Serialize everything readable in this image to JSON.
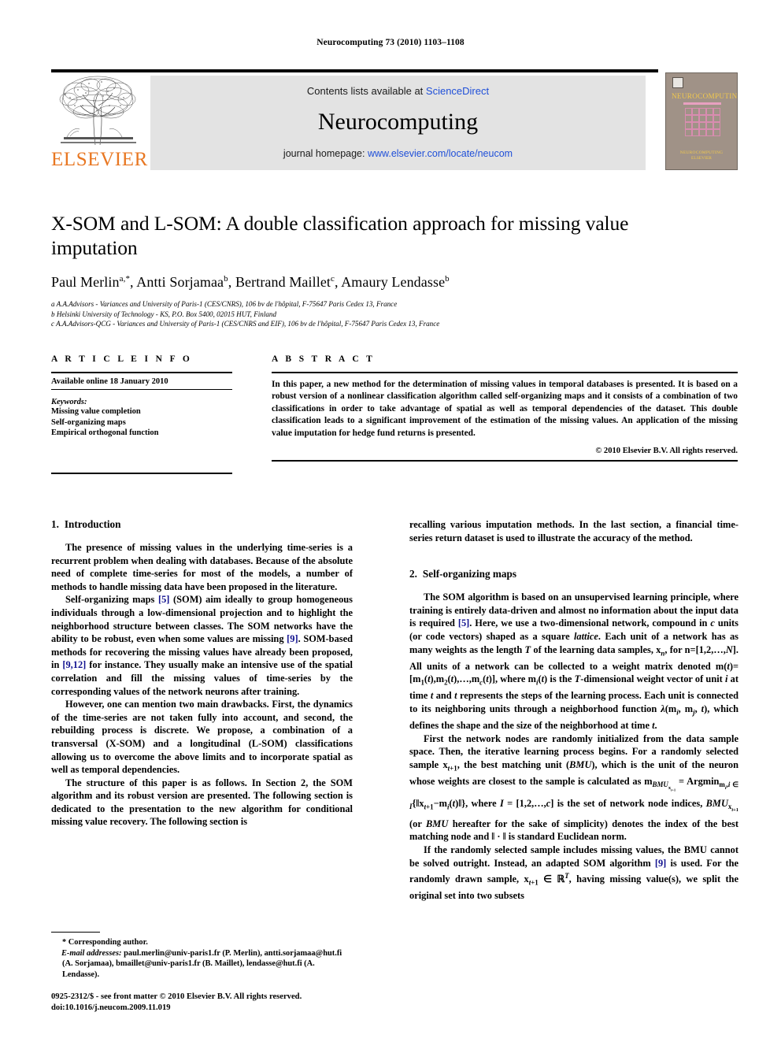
{
  "running_head": "Neurocomputing 73 (2010) 1103–1108",
  "masthead": {
    "contents_prefix": "Contents lists available at ",
    "contents_link": "ScienceDirect",
    "journal_name": "Neurocomputing",
    "homepage_prefix": "journal homepage: ",
    "homepage_link": "www.elsevier.com/locate/neucom",
    "publisher": "ELSEVIER",
    "cover": {
      "title": "NEUROCOMPUTING",
      "foot_line1": "NEUROCOMPUTING",
      "foot_line2": "ELSEVIER"
    }
  },
  "article": {
    "title": "X-SOM and L-SOM: A double classification approach for missing value imputation",
    "authors": "Paul Merlin a,*, Antti Sorjamaa b, Bertrand Maillet c, Amaury Lendasse b",
    "affiliations": [
      "a A.A.Advisors - Variances and University of Paris-1 (CES/CNRS), 106 bv de l'hôpital, F-75647 Paris Cedex 13, France",
      "b Helsinki University of Technology - KS, P.O. Box 5400, 02015 HUT, Finland",
      "c A.A.Advisors-QCG - Variances and University of Paris-1 (CES/CNRS and EIF), 106 bv de l'hôpital, F-75647 Paris Cedex 13, France"
    ]
  },
  "info": {
    "heading": "A R T I C L E  I N F O",
    "history": "Available online 18 January 2010",
    "keywords_label": "Keywords:",
    "keywords": [
      "Missing value completion",
      "Self-organizing maps",
      "Empirical orthogonal function"
    ]
  },
  "abstract": {
    "heading": "A B S T R A C T",
    "text": "In this paper, a new method for the determination of missing values in temporal databases is presented. It is based on a robust version of a nonlinear classification algorithm called self-organizing maps and it consists of a combination of two classifications in order to take advantage of spatial as well as temporal dependencies of the dataset. This double classification leads to a significant improvement of the estimation of the missing values. An application of the missing value imputation for hedge fund returns is presented.",
    "copyright": "© 2010 Elsevier B.V. All rights reserved."
  },
  "sections": {
    "intro": {
      "number": "1.",
      "title": "Introduction",
      "p1": "The presence of missing values in the underlying time-series is a recurrent problem when dealing with databases. Because of the absolute need of complete time-series for most of the models, a number of methods to handle missing data have been proposed in the literature.",
      "p2_a": "Self-organizing maps ",
      "p2_ref1": "[5]",
      "p2_b": " (SOM) aim ideally to group homogeneous individuals through a low-dimensional projection and to highlight the neighborhood structure between classes. The SOM networks have the ability to be robust, even when some values are missing ",
      "p2_ref2": "[9]",
      "p2_c": ". SOM-based methods for recovering the missing values have already been proposed, in ",
      "p2_ref3": "[9,12]",
      "p2_d": " for instance. They usually make an intensive use of the spatial correlation and fill the missing values of time-series by the corresponding values of the network neurons after training.",
      "p3": "However, one can mention two main drawbacks. First, the dynamics of the time-series are not taken fully into account, and second, the rebuilding process is discrete. We propose, a combination of a transversal (X-SOM) and a longitudinal (L-SOM) classifications allowing us to overcome the above limits and to incorporate spatial as well as temporal dependencies.",
      "p4": "The structure of this paper is as follows. In Section 2, the SOM algorithm and its robust version are presented. The following section is dedicated to the presentation to the new algorithm for conditional missing value recovery. The following section is recalling various imputation methods. In the last section, a financial time-series return dataset is used to illustrate the accuracy of the method."
    },
    "som": {
      "number": "2.",
      "title": "Self-organizing maps",
      "p1_a": "The SOM algorithm is based on an unsupervised learning principle, where training is entirely data-driven and almost no information about the input data is required ",
      "p1_ref": "[5]",
      "p1_b": ". Here, we use a two-dimensional network, compound in c units (or code vectors) shaped as a square lattice. Each unit of a network has as many weights as the length T of the learning data samples, x",
      "p1_c": ", for n=[1,2,…,N]. All units of a network can be collected to a weight matrix denoted m(t)=[m",
      "p1_d": "(t),m",
      "p1_e": "(t),…,m",
      "p1_f": "(t)], where m",
      "p1_g": "(t) is the T-dimensional weight vector of unit i at time t and t represents the steps of the learning process. Each unit is connected to its neighboring units through a neighborhood function λ(m",
      "p1_h": ", m",
      "p1_i": ", t), which defines the shape and the size of the neighborhood at time t.",
      "p2_a": "First the network nodes are randomly initialized from the data sample space. Then, the iterative learning process begins. For a randomly selected sample x",
      "p2_b": ", the best matching unit (BMU), which is the unit of the neuron whose weights are closest to the sample is calculated as m",
      "p2_c": " = Argmin",
      "p2_d": "{‖x",
      "p2_e": "−m",
      "p2_f": "(t)‖}, where I = [1,2,…,c] is the set of network node indices, BMU",
      "p2_g": " (or BMU hereafter for the sake of simplicity) denotes the index of the best matching node and ‖ · ‖ is standard Euclidean norm.",
      "p3_a": "If the randomly selected sample includes missing values, the BMU cannot be solved outright. Instead, an adapted SOM algorithm ",
      "p3_ref": "[9]",
      "p3_b": " is used. For the randomly drawn sample, x",
      "p3_c": " ∈ ℝ",
      "p3_d": ", having missing value(s), we split the original set into two subsets"
    }
  },
  "footnote": {
    "corresponding": "* Corresponding author.",
    "email_label": "E-mail addresses:",
    "emails": "paul.merlin@univ-paris1.fr (P. Merlin), antti.sorjamaa@hut.fi (A. Sorjamaa), bmaillet@univ-paris1.fr (B. Maillet), lendasse@hut.fi (A. Lendasse)."
  },
  "issn": {
    "line1": "0925-2312/$ - see front matter © 2010 Elsevier B.V. All rights reserved.",
    "line2": "doi:10.1016/j.neucom.2009.11.019"
  },
  "colors": {
    "link": "#1f4fd8",
    "reference": "#11118f",
    "elsevier_orange": "#e87722",
    "banner_gray": "#e3e3e3",
    "cover_bg": "#a09287",
    "cover_title": "#f2c94c"
  }
}
